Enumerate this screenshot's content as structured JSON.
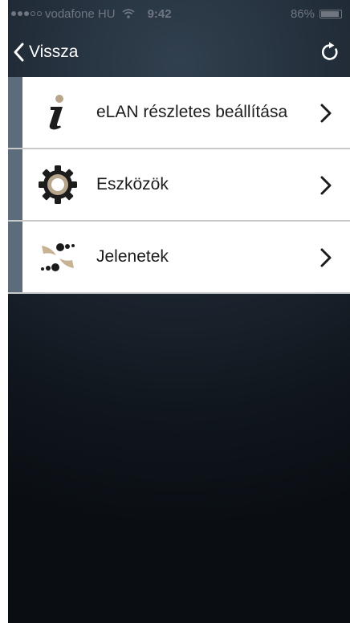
{
  "status_bar": {
    "carrier": "vodafone HU",
    "time": "9:42",
    "battery": "86%"
  },
  "nav": {
    "back_label": "Vissza"
  },
  "menu": {
    "items": [
      {
        "label": "eLAN részletes beállítása",
        "icon": "info-icon"
      },
      {
        "label": "Eszközök",
        "icon": "gear-icon"
      },
      {
        "label": "Jelenetek",
        "icon": "scenes-icon"
      }
    ]
  },
  "colors": {
    "background_top": "#31404f",
    "background_bottom": "#0a0e13",
    "row_accent": "#5d6c7a",
    "info_dot": "#b8a68c",
    "scene_swoosh": "#c7b393"
  }
}
